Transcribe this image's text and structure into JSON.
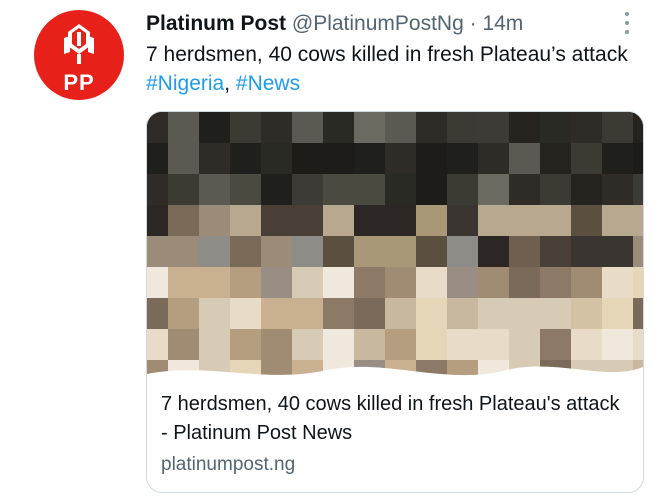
{
  "tweet": {
    "author_name": "Platinum Post",
    "handle": "@PlatinumPostNg",
    "separator": "·",
    "time": "14m",
    "text_prefix": "7 herdsmen, 40 cows killed in fresh Plateau’s attack ",
    "hashtag_1": "#Nigeria",
    "comma": ", ",
    "hashtag_2": "#News"
  },
  "avatar": {
    "logo_text": "PP",
    "color": "#e8201a"
  },
  "card": {
    "title": "7 herdsmen, 40 cows killed in fresh Plateau's attack - Platinum Post News",
    "domain": "platinumpost.ng",
    "image": "censored-pixelated-image"
  },
  "colors": {
    "link": "#1d9bf0",
    "secondary_text": "#536471",
    "border": "#cfd9de"
  }
}
